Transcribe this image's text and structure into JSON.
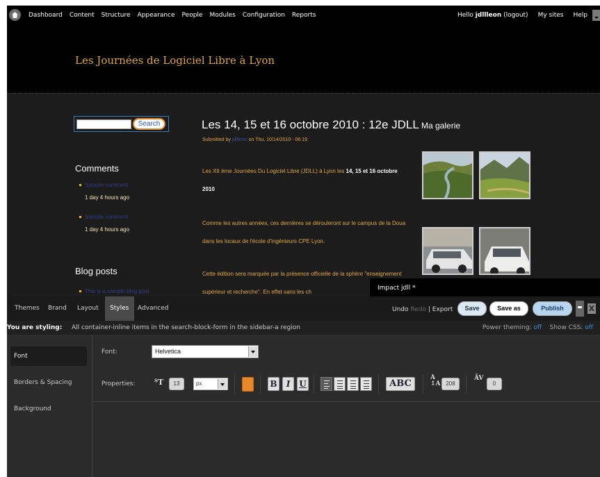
{
  "admin_bar": {
    "menu": [
      "Dashboard",
      "Content",
      "Structure",
      "Appearance",
      "People",
      "Modules",
      "Configuration",
      "Reports"
    ],
    "hello": "Hello",
    "username": "jdllleon",
    "logout": "(logout)",
    "my_sites": "My sites",
    "help": "Help"
  },
  "site": {
    "title": "Les Journées de Logiciel Libre à Lyon",
    "search_button": "Search",
    "comments_title": "Comments",
    "comments": [
      {
        "link": "Sample comment",
        "meta": "1 day 4 hours ago"
      },
      {
        "link": "Sample comment",
        "meta": "1 day 4 hours ago"
      }
    ],
    "blog_title": "Blog posts",
    "blog_items": [
      "This is a sample blog post"
    ],
    "article": {
      "title": "Les 14, 15 et 16 octobre 2010 : 12e JDLL",
      "submitted_by": "Submitted by",
      "author": "jdllleon",
      "date": "on Thu, 10/14/2010 - 06:19",
      "p1_text": "Les XII ème Journées Du Logiciel Libre (JDLL) à Lyon les",
      "p1_bold": "14, 15 et 16 octobre 2010",
      "p2": "Comme les autres années, ces dernières se dérouleront sur le campus de la Doua dans les locaux de l'école d'ingénieurs CPE Lyon.",
      "p3": "Cette édition sera marquée par la présence officielle de la sphère \"enseignement supérieur et recherche\". En effet sans les ch"
    },
    "gallery_title": "Ma galerie",
    "impact_tab": "Impact jdll *"
  },
  "editor": {
    "tabs": [
      "Themes",
      "Brand",
      "Layout",
      "Styles",
      "Advanced"
    ],
    "active_tab": "Styles",
    "undo": "Undo",
    "redo": "Redo",
    "divider": "|",
    "export": "Export",
    "save": "Save",
    "save_as": "Save as",
    "publish": "Publish",
    "close": "X",
    "styling_label": "You are styling:",
    "styling_desc": "All container-inline items in the search-block-form in the sidebar-a region",
    "power_theming": "Power theming:",
    "power_value": "off",
    "show_css": "Show CSS:",
    "show_css_value": "off",
    "side_menu": [
      "Font",
      "Borders & Spacing",
      "Background"
    ],
    "font_label": "Font:",
    "font_value": "Helvetica",
    "properties_label": "Properties:",
    "font_size": "13",
    "unit": "px",
    "bold": "B",
    "italic": "I",
    "underline": "U",
    "case": "ABC",
    "line_height": "208",
    "letter_spacing": "0",
    "accent_color": "#e8862a"
  }
}
